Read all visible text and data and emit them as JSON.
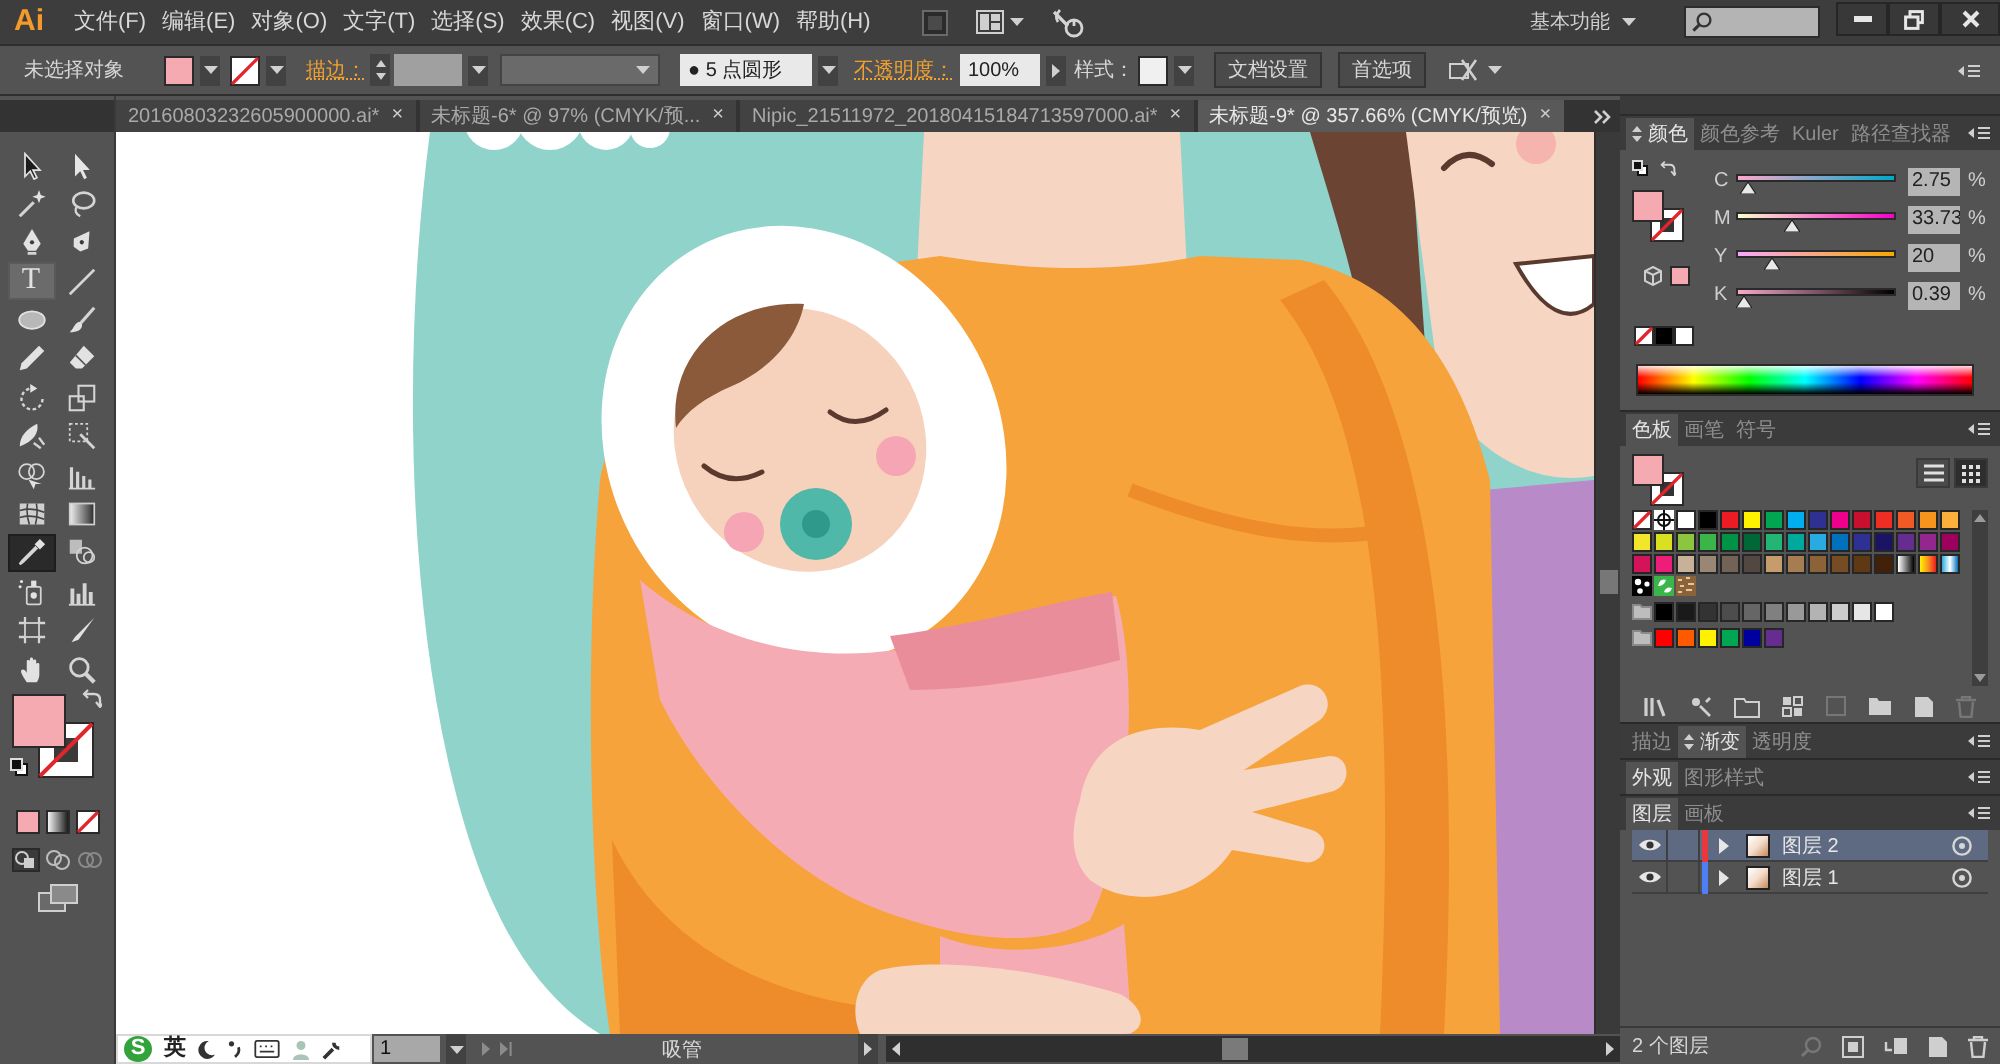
{
  "menu_bar": {
    "logo": "Ai",
    "items": [
      "文件(F)",
      "编辑(E)",
      "对象(O)",
      "文字(T)",
      "选择(S)",
      "效果(C)",
      "视图(V)",
      "窗口(W)",
      "帮助(H)"
    ],
    "workspace": "基本功能"
  },
  "control_bar": {
    "selection_status": "未选择对象",
    "fill_swatch": {
      "color": "#f5a9b0"
    },
    "stroke_link": "描边：",
    "brush": "● 5 点圆形",
    "opacity_link": "不透明度：",
    "opacity": "100%",
    "style_label": "样式：",
    "buttons": [
      "文档设置",
      "首选项"
    ]
  },
  "document_tabs": [
    {
      "title": "20160803232605900000.ai*",
      "close": "×",
      "selected": false
    },
    {
      "title": "未标题-6* @ 97% (CMYK/预...",
      "close": "×",
      "selected": false
    },
    {
      "title": "Nipic_21511972_20180415184713597000.ai*",
      "close": "×",
      "selected": false
    },
    {
      "title": "未标题-9* @ 357.66% (CMYK/预览)",
      "close": "×",
      "selected": true
    }
  ],
  "tools": [
    {
      "kind": "selection",
      "selected": false,
      "hovered": false
    },
    {
      "kind": "direct_selection",
      "selected": false,
      "hovered": false
    },
    {
      "kind": "magic_wand",
      "selected": false,
      "hovered": false
    },
    {
      "kind": "lasso",
      "selected": false,
      "hovered": false
    },
    {
      "kind": "pen",
      "selected": false,
      "hovered": false
    },
    {
      "kind": "curvature",
      "selected": false,
      "hovered": false
    },
    {
      "kind": "type",
      "label": "T",
      "selected": false,
      "hovered": true
    },
    {
      "kind": "line",
      "selected": false,
      "hovered": false
    },
    {
      "kind": "ellipse",
      "selected": false,
      "hovered": false
    },
    {
      "kind": "paintbrush",
      "selected": false,
      "hovered": false
    },
    {
      "kind": "pencil",
      "selected": false,
      "hovered": false
    },
    {
      "kind": "eraser",
      "selected": false,
      "hovered": false
    },
    {
      "kind": "rotate",
      "selected": false,
      "hovered": false
    },
    {
      "kind": "scale",
      "selected": false,
      "hovered": false
    },
    {
      "kind": "width",
      "selected": false,
      "hovered": false
    },
    {
      "kind": "free_transform",
      "selected": false,
      "hovered": false
    },
    {
      "kind": "shape_builder",
      "selected": false,
      "hovered": false
    },
    {
      "kind": "perspective",
      "selected": false,
      "hovered": false
    },
    {
      "kind": "mesh",
      "selected": false,
      "hovered": false
    },
    {
      "kind": "gradient",
      "selected": false,
      "hovered": false
    },
    {
      "kind": "eyedropper",
      "selected": true,
      "hovered": false
    },
    {
      "kind": "blend",
      "selected": false,
      "hovered": false
    },
    {
      "kind": "symbol_sprayer",
      "selected": false,
      "hovered": false
    },
    {
      "kind": "column_graph",
      "selected": false,
      "hovered": false
    },
    {
      "kind": "artboard",
      "selected": false,
      "hovered": false
    },
    {
      "kind": "slice",
      "selected": false,
      "hovered": false
    },
    {
      "kind": "hand",
      "selected": false,
      "hovered": false
    },
    {
      "kind": "zoom",
      "selected": false,
      "hovered": false
    }
  ],
  "tool_colors": {
    "fill_swatch": {
      "color": "#f5a9b0"
    }
  },
  "color_panel": {
    "tabs": [
      {
        "label": "颜色",
        "selected": true,
        "options_toggle": true
      },
      {
        "label": "颜色参考",
        "selected": false
      },
      {
        "label": "Kuler",
        "selected": false
      },
      {
        "label": "路径查找器",
        "selected": false
      }
    ],
    "fill_swatch": {
      "color": "#f5a9b0"
    },
    "channels": [
      {
        "name": "C",
        "value": "2.75",
        "unit": "%",
        "level": 0.0275
      },
      {
        "name": "M",
        "value": "33.73",
        "unit": "%",
        "level": 0.3373
      },
      {
        "name": "Y",
        "value": "20",
        "unit": "%",
        "level": 0.2
      },
      {
        "name": "K",
        "value": "0.39",
        "unit": "%",
        "level": 0.0039
      }
    ],
    "quick_swatches": [
      {
        "kind": "none"
      },
      {
        "kind": "solid",
        "color": "#000000"
      },
      {
        "kind": "solid",
        "color": "#ffffff"
      }
    ]
  },
  "swatches_panel": {
    "tabs": [
      {
        "label": "色板",
        "selected": true
      },
      {
        "label": "画笔",
        "selected": false
      },
      {
        "label": "符号",
        "selected": false
      }
    ],
    "fill_swatch": {
      "color": "#f5a9b0"
    },
    "views": [
      {
        "kind": "list",
        "selected": false
      },
      {
        "kind": "grid",
        "selected": true
      }
    ],
    "rows": [
      {
        "kind": "swatches",
        "items": [
          {
            "kind": "none"
          },
          {
            "kind": "registration"
          },
          {
            "kind": "solid",
            "color": "#ffffff"
          },
          {
            "kind": "solid",
            "color": "#000000"
          },
          {
            "kind": "solid",
            "color": "#ed1c24"
          },
          {
            "kind": "solid",
            "color": "#fff200"
          },
          {
            "kind": "solid",
            "color": "#00a651"
          },
          {
            "kind": "solid",
            "color": "#00aeef"
          },
          {
            "kind": "solid",
            "color": "#2e3192"
          },
          {
            "kind": "solid",
            "color": "#ec008c"
          },
          {
            "kind": "solid",
            "color": "#c8102e"
          },
          {
            "kind": "solid",
            "color": "#ee2d24"
          },
          {
            "kind": "solid",
            "color": "#f15a24"
          },
          {
            "kind": "solid",
            "color": "#f7941d"
          },
          {
            "kind": "solid",
            "color": "#fbb03b"
          }
        ]
      },
      {
        "kind": "swatches",
        "items": [
          {
            "kind": "solid",
            "color": "#f2e52c"
          },
          {
            "kind": "solid",
            "color": "#d9e021"
          },
          {
            "kind": "solid",
            "color": "#8cc63f"
          },
          {
            "kind": "solid",
            "color": "#39b54a"
          },
          {
            "kind": "solid",
            "color": "#009245"
          },
          {
            "kind": "solid",
            "color": "#006837"
          },
          {
            "kind": "solid",
            "color": "#22b573"
          },
          {
            "kind": "solid",
            "color": "#00a99d"
          },
          {
            "kind": "solid",
            "color": "#29abe2"
          },
          {
            "kind": "solid",
            "color": "#0071bc"
          },
          {
            "kind": "solid",
            "color": "#2e3192"
          },
          {
            "kind": "solid",
            "color": "#1b1464"
          },
          {
            "kind": "solid",
            "color": "#662d91"
          },
          {
            "kind": "solid",
            "color": "#93278f"
          },
          {
            "kind": "solid",
            "color": "#9e005d"
          }
        ]
      },
      {
        "kind": "swatches",
        "items": [
          {
            "kind": "solid",
            "color": "#d4145a"
          },
          {
            "kind": "solid",
            "color": "#ed1e79"
          },
          {
            "kind": "solid",
            "color": "#c7b299"
          },
          {
            "kind": "solid",
            "color": "#998675"
          },
          {
            "kind": "solid",
            "color": "#736357"
          },
          {
            "kind": "solid",
            "color": "#534741"
          },
          {
            "kind": "solid",
            "color": "#c69c6d"
          },
          {
            "kind": "solid",
            "color": "#a67c52"
          },
          {
            "kind": "solid",
            "color": "#8c6239"
          },
          {
            "kind": "solid",
            "color": "#754c24"
          },
          {
            "kind": "solid",
            "color": "#603813"
          },
          {
            "kind": "solid",
            "color": "#42210b"
          },
          {
            "kind": "gradient_mono"
          },
          {
            "kind": "gradient_warm"
          },
          {
            "kind": "gradient_cool"
          }
        ]
      },
      {
        "kind": "swatches",
        "items": [
          {
            "kind": "pattern_dots"
          },
          {
            "kind": "pattern_leaves"
          },
          {
            "kind": "pattern_texture"
          }
        ]
      },
      {
        "kind": "group",
        "items": [
          {
            "kind": "solid",
            "color": "#000000"
          },
          {
            "kind": "solid",
            "color": "#1a1a1a"
          },
          {
            "kind": "solid",
            "color": "#333333"
          },
          {
            "kind": "solid",
            "color": "#4d4d4d"
          },
          {
            "kind": "solid",
            "color": "#666666"
          },
          {
            "kind": "solid",
            "color": "#808080"
          },
          {
            "kind": "solid",
            "color": "#999999"
          },
          {
            "kind": "solid",
            "color": "#b3b3b3"
          },
          {
            "kind": "solid",
            "color": "#cccccc"
          },
          {
            "kind": "solid",
            "color": "#e6e6e6"
          },
          {
            "kind": "solid",
            "color": "#ffffff"
          }
        ]
      },
      {
        "kind": "group",
        "items": [
          {
            "kind": "solid",
            "color": "#ff0000"
          },
          {
            "kind": "solid",
            "color": "#ff5a00"
          },
          {
            "kind": "solid",
            "color": "#fff200"
          },
          {
            "kind": "solid",
            "color": "#00a651"
          },
          {
            "kind": "solid",
            "color": "#0000a0"
          },
          {
            "kind": "solid",
            "color": "#662d91"
          }
        ]
      }
    ]
  },
  "stroke_panel": {
    "tabs": [
      {
        "label": "描边",
        "selected": false
      },
      {
        "label": "渐变",
        "selected": true,
        "options_toggle": true
      },
      {
        "label": "透明度",
        "selected": false
      }
    ]
  },
  "appearance_panel": {
    "tabs": [
      {
        "label": "外观",
        "selected": true
      },
      {
        "label": "图形样式",
        "selected": false
      }
    ]
  },
  "layers_panel": {
    "tabs": [
      {
        "label": "图层",
        "selected": true
      },
      {
        "label": "画板",
        "selected": false
      }
    ],
    "layers": [
      {
        "name": "图层 2",
        "selected": true,
        "visible": true,
        "expanded": false,
        "color": "#e8373d"
      },
      {
        "name": "图层 1",
        "selected": false,
        "visible": true,
        "expanded": false,
        "color": "#4f7ff7"
      }
    ],
    "count": "2 个图层"
  },
  "status_bar": {
    "artboard": "1",
    "tool": "吸管"
  },
  "ime_toolbar": {
    "logo": "S",
    "mode": "英"
  }
}
